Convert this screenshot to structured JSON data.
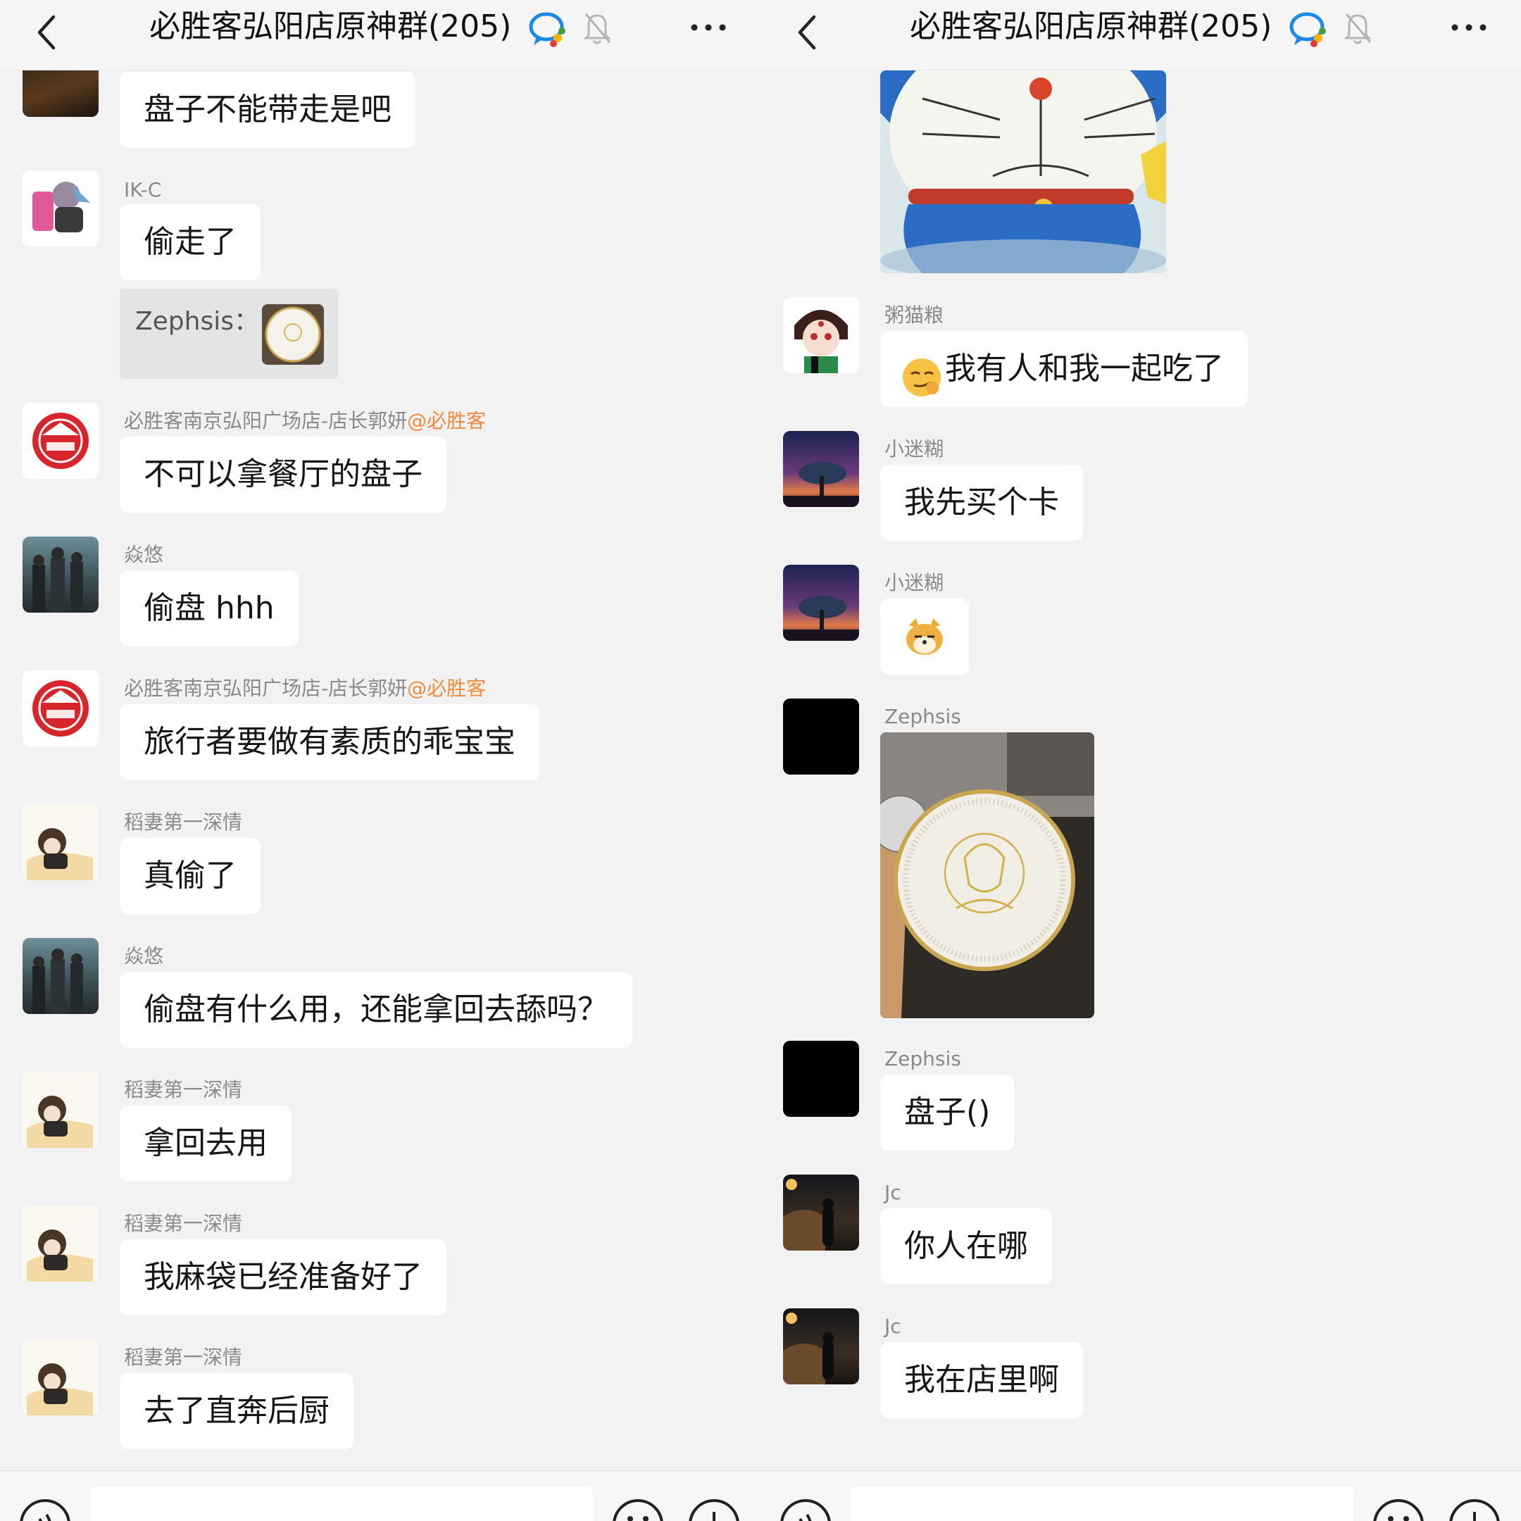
{
  "left": {
    "title": "必胜客弘阳店原神群(205)",
    "messages": [
      {
        "text": "盘子不能带走是吧"
      },
      {
        "nick": "IK-C",
        "text": "偷走了"
      },
      {
        "quote": "Zephsis："
      },
      {
        "nick": "必胜客南京弘阳广场店-店长郭妍",
        "at": "@必胜客",
        "text": "不可以拿餐厅的盘子"
      },
      {
        "nick": "焱悠",
        "text": "偷盘 hhh"
      },
      {
        "nick": "必胜客南京弘阳广场店-店长郭妍",
        "at": "@必胜客",
        "text": "旅行者要做有素质的乖宝宝"
      },
      {
        "nick": "稻妻第一深情",
        "text": "真偷了"
      },
      {
        "nick": "焱悠",
        "text": "偷盘有什么用，还能拿回去舔吗？"
      },
      {
        "nick": "稻妻第一深情",
        "text": "拿回去用"
      },
      {
        "nick": "稻妻第一深情",
        "text": "我麻袋已经准备好了"
      },
      {
        "nick": "稻妻第一深情",
        "text": "去了直奔后厨"
      }
    ]
  },
  "right": {
    "title": "必胜客弘阳店原神群(205)",
    "messages": [
      {
        "nick": "粥猫粮",
        "text": "我有人和我一起吃了"
      },
      {
        "nick": "小迷糊",
        "text": "我先买个卡"
      },
      {
        "nick": "小迷糊"
      },
      {
        "nick": "Zephsis"
      },
      {
        "nick": "Zephsis",
        "text": "盘子()"
      },
      {
        "nick": "Jc",
        "text": "你人在哪"
      },
      {
        "nick": "Jc",
        "text": "我在店里啊"
      }
    ]
  },
  "colors": {
    "background": "#f2f2f2",
    "bubble": "#ffffff",
    "nick": "#8a8a8a",
    "at_mention": "#f08a3c",
    "pizza_red": "#d7262b"
  },
  "icons": [
    "back-chevron-icon",
    "group-chat-icon",
    "mute-bell-icon",
    "more-dots-icon",
    "voice-icon",
    "emoji-icon",
    "plus-icon"
  ]
}
